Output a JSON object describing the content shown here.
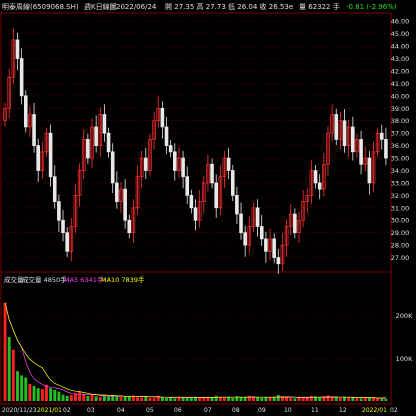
{
  "header": {
    "symbol_name": "明泰周線",
    "symbol_code": "(6509068.SH)",
    "period_label": "週K日線圖",
    "date": "2022/06/24",
    "open_label": "開",
    "open": "27.35",
    "high_label": "高",
    "high": "27.73",
    "low_label": "低",
    "low": "26.04",
    "close_label": "收",
    "close": "26.53",
    "close_suffix": "e",
    "volume_label": "量",
    "volume": "62322",
    "volume_unit": "手",
    "change": "-0.81",
    "change_pct": "(-2.96%)"
  },
  "volume_legend": {
    "title": "成交量",
    "vol_label": "成交量",
    "vol_value": "4850",
    "vol_unit": "手",
    "ma5_label": "MA5",
    "ma5_value": "6341",
    "ma5_unit": "手",
    "ma10_label": "MA10",
    "ma10_value": "7839",
    "ma10_unit": "手"
  },
  "colors": {
    "background": "#000000",
    "up": "#ff3030",
    "down": "#e8e8e8",
    "volume_up": "#ff2020",
    "volume_down": "#22c022",
    "ma5": "#ff40ff",
    "ma10": "#ffff00",
    "grid": "#7a0000",
    "axis_text": "#e0e0e0",
    "date_highlight": "#ffff00"
  },
  "chart_data": [
    {
      "type": "candlestick",
      "title": "",
      "ylim": [
        26.0,
        46.5
      ],
      "y_ticks": [
        "46.00",
        "45.00",
        "44.00",
        "43.00",
        "42.00",
        "41.00",
        "40.00",
        "39.00",
        "38.00",
        "37.00",
        "36.00",
        "35.00",
        "34.00",
        "33.00",
        "32.00",
        "31.00",
        "30.00",
        "29.00",
        "28.00",
        "27.00"
      ],
      "grid": true,
      "series": [
        {
          "close": [
            39.0,
            41.5,
            44.5,
            43.0,
            40.0,
            37.5,
            38.5,
            36.0,
            34.0,
            35.5,
            37.0,
            33.5,
            31.5,
            30.0,
            29.0,
            27.5,
            29.5,
            32.0,
            34.0,
            36.5,
            35.0,
            37.5,
            36.0,
            38.5,
            37.0,
            35.5,
            33.0,
            31.5,
            32.5,
            30.0,
            29.0,
            31.0,
            33.5,
            35.0,
            34.0,
            36.5,
            38.0,
            39.0,
            37.5,
            36.0,
            35.5,
            34.0,
            35.0,
            33.5,
            32.0,
            31.0,
            30.0,
            31.5,
            33.0,
            34.5,
            33.0,
            31.0,
            33.5,
            35.0,
            34.0,
            32.0,
            30.5,
            29.0,
            28.0,
            29.5,
            31.0,
            29.5,
            28.5,
            27.5,
            28.5,
            27.0,
            26.5,
            28.0,
            29.5,
            30.5,
            29.0,
            30.0,
            31.5,
            32.0,
            34.0,
            33.0,
            32.5,
            34.5,
            37.0,
            38.5,
            36.5,
            38.0,
            36.0,
            37.5,
            35.5,
            36.5,
            34.5,
            35.0,
            33.0,
            35.5,
            37.0,
            36.5,
            35.0
          ]
        }
      ]
    },
    {
      "type": "bar",
      "title": "",
      "ylim": [
        0,
        260000
      ],
      "y_ticks": [
        "200K",
        "100K"
      ],
      "x_ticks": [
        "2020/11/23",
        "2021/01",
        "02",
        "03",
        "04",
        "05",
        "06",
        "07",
        "08",
        "09",
        "10",
        "11",
        "12",
        "2022/01",
        "02"
      ],
      "series": [
        {
          "name": "成交量",
          "values": [
            230000,
            150000,
            120000,
            70000,
            60000,
            55000,
            40000,
            35000,
            30000,
            28000,
            38000,
            30000,
            26000,
            22000,
            15000,
            12000,
            14000,
            18000,
            22000,
            16000,
            12000,
            14000,
            11000,
            9000,
            12000,
            10000,
            14000,
            11000,
            9000,
            10000,
            12000,
            13000,
            9000,
            8000,
            10000,
            8000,
            7000,
            12000,
            9000,
            7000,
            8000,
            6000,
            10000,
            8000,
            7000,
            9000,
            10000,
            8000,
            9000,
            7000,
            8000,
            12000,
            9000,
            8000,
            10000,
            7000,
            11000,
            8000,
            9000,
            12000,
            10000,
            8000,
            7000,
            9000,
            8000,
            10000,
            14000,
            11000,
            9000,
            7000,
            6000,
            8000,
            7000,
            9000,
            12000,
            11000,
            8000,
            10000,
            13000,
            9000,
            8000,
            7000,
            10000,
            9000,
            8000,
            7000,
            6000,
            9000,
            8000,
            7000,
            6000,
            5000,
            4850
          ],
          "up": [
            true,
            false,
            true,
            false,
            false,
            false,
            true,
            false,
            false,
            true,
            true,
            false,
            false,
            false,
            false,
            false,
            true,
            true,
            true,
            true,
            false,
            true,
            false,
            true,
            false,
            false,
            false,
            false,
            true,
            false,
            false,
            true,
            true,
            true,
            false,
            true,
            true,
            true,
            false,
            false,
            false,
            false,
            true,
            false,
            false,
            false,
            false,
            true,
            true,
            true,
            false,
            false,
            true,
            true,
            false,
            false,
            false,
            false,
            false,
            true,
            true,
            false,
            false,
            false,
            true,
            false,
            false,
            true,
            true,
            true,
            false,
            true,
            true,
            true,
            true,
            false,
            false,
            true,
            true,
            true,
            false,
            true,
            false,
            true,
            false,
            true,
            false,
            true,
            false,
            true,
            true,
            false,
            false
          ]
        },
        {
          "name": "MA5",
          "values": [
            230000,
            190000,
            166000,
            142000,
            126000,
            91000,
            67000,
            52000,
            45000,
            39000,
            34000,
            32000,
            31000,
            29000,
            26000,
            21000,
            18000,
            16000,
            16000,
            16000,
            15000,
            15000,
            15000,
            12000,
            12000,
            11000,
            12000,
            11000,
            11000,
            11000,
            11000,
            11000,
            11000,
            10000,
            10000,
            10000,
            9000,
            9000,
            9000,
            9000,
            8000,
            8000,
            9000,
            8000,
            8000,
            8000,
            9000,
            8000,
            9000,
            9000,
            8000,
            9000,
            9000,
            9000,
            9000,
            9000,
            9000,
            9000,
            9000,
            10000,
            10000,
            9000,
            9000,
            9000,
            9000,
            9000,
            10000,
            10000,
            10000,
            10000,
            9000,
            8000,
            8000,
            7000,
            8000,
            9000,
            9000,
            10000,
            11000,
            10000,
            10000,
            9000,
            9000,
            9000,
            8000,
            8000,
            8000,
            8000,
            8000,
            7000,
            7000,
            6000,
            6341
          ]
        },
        {
          "name": "MA10",
          "values": [
            230000,
            190000,
            166000,
            142000,
            126000,
            110000,
            98000,
            90000,
            83000,
            78000,
            62000,
            49000,
            41000,
            37000,
            33000,
            28000,
            25000,
            23000,
            22000,
            20000,
            18000,
            16000,
            15000,
            14000,
            14000,
            13000,
            13000,
            12000,
            12000,
            11000,
            11000,
            11000,
            11000,
            11000,
            11000,
            10000,
            10000,
            10000,
            9000,
            9000,
            9000,
            9000,
            9000,
            9000,
            9000,
            9000,
            9000,
            8000,
            8000,
            8000,
            8000,
            9000,
            9000,
            9000,
            9000,
            9000,
            9000,
            9000,
            9000,
            9000,
            9000,
            9000,
            9000,
            9000,
            9000,
            9000,
            9000,
            9000,
            9000,
            9000,
            9000,
            9000,
            9000,
            9000,
            9000,
            9000,
            9000,
            9000,
            9000,
            9000,
            9000,
            9000,
            9000,
            9000,
            9000,
            8000,
            8000,
            8000,
            8000,
            8000,
            7000,
            7000,
            7839
          ]
        }
      ]
    }
  ]
}
